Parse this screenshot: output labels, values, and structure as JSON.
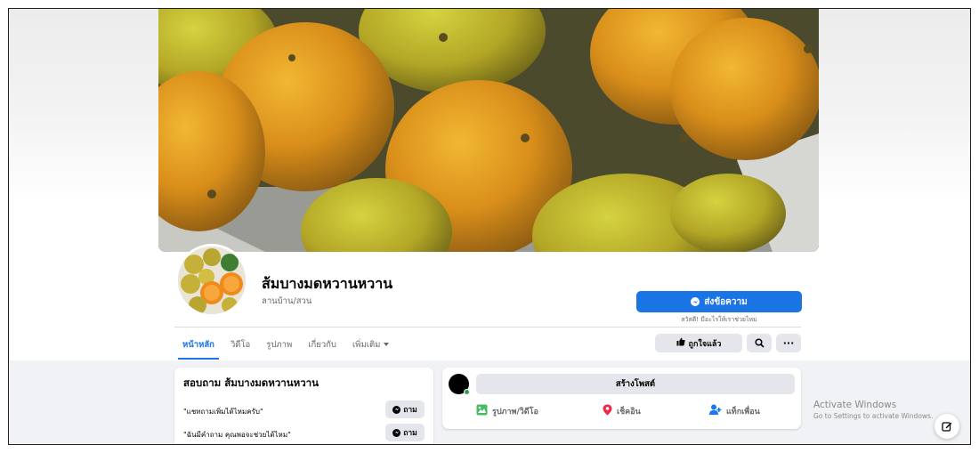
{
  "page": {
    "name": "ส้มบางมดหวานหวาน",
    "category": "ลานบ้าน/สวน"
  },
  "actions": {
    "send_message_label": "ส่งข้อความ",
    "send_message_sub": "สวัสดี! มีอะไรให้เราช่วยไหม",
    "like_label": "ถูกใจแล้ว",
    "more_label": "···"
  },
  "tabs": [
    {
      "label": "หน้าหลัก",
      "active": true
    },
    {
      "label": "วิดีโอ",
      "active": false
    },
    {
      "label": "รูปภาพ",
      "active": false
    },
    {
      "label": "เกี่ยวกับ",
      "active": false
    },
    {
      "label": "เพิ่มเติม",
      "active": false
    }
  ],
  "ask": {
    "title": "สอบถาม ส้มบางมดหวานหวาน",
    "questions": [
      {
        "text": "\"แชทถามเพิ่มได้ไหมครับ\"",
        "button": "ถาม"
      },
      {
        "text": "\"ฉันมีคำถาม คุณพอจะช่วยได้ไหม\"",
        "button": "ถาม"
      }
    ]
  },
  "composer": {
    "create_post_label": "สร้างโพสต์",
    "photo_video_label": "รูปภาพ/วิดีโอ",
    "check_in_label": "เช็คอิน",
    "tag_friends_label": "แท็กเพื่อน"
  },
  "os_watermark": {
    "line1": "Activate Windows",
    "line2": "Go to Settings to activate Windows."
  },
  "colors": {
    "accent": "#1b74e4",
    "online": "#31a24c",
    "photo_icon": "#45bd62",
    "checkin_icon": "#f02849",
    "tag_icon": "#1877f2"
  },
  "icons": [
    "messenger-icon",
    "thumbs-up-icon",
    "search-icon",
    "more-icon",
    "photo-icon",
    "location-pin-icon",
    "tag-people-icon",
    "compose-icon"
  ]
}
